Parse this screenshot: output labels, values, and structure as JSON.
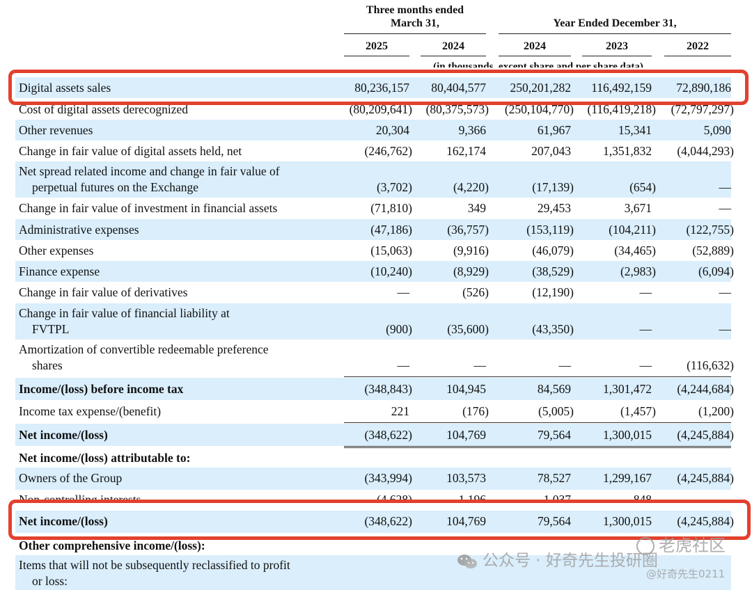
{
  "header": {
    "group1": "Three months ended\nMarch 31,",
    "group2": "Year Ended December 31,",
    "years": [
      "2025",
      "2024",
      "2024",
      "2023",
      "2022"
    ],
    "units_note": "(in thousands, except share and per share data)"
  },
  "rows": [
    {
      "label": "Digital assets sales",
      "values": [
        "80,236,157",
        "80,404,577",
        "250,201,282",
        "116,492,159",
        "72,890,186"
      ]
    },
    {
      "label": "Cost of digital assets derecognized",
      "values": [
        "(80,209,641)",
        "(80,375,573)",
        "(250,104,770)",
        "(116,419,218)",
        "(72,797,297)"
      ]
    },
    {
      "label": "Other revenues",
      "values": [
        "20,304",
        "9,366",
        "61,967",
        "15,341",
        "5,090"
      ]
    },
    {
      "label": "Change in fair value of digital assets held, net",
      "values": [
        "(246,762)",
        "162,174",
        "207,043",
        "1,351,832",
        "(4,044,293)"
      ]
    },
    {
      "label": "Net spread related income and change in fair value of\nperpetual futures on the Exchange",
      "values": [
        "(3,702)",
        "(4,220)",
        "(17,139)",
        "(654)",
        "—"
      ]
    },
    {
      "label": "Change in fair value of investment in financial assets",
      "values": [
        "(71,810)",
        "349",
        "29,453",
        "3,671",
        "—"
      ]
    },
    {
      "label": "Administrative expenses",
      "values": [
        "(47,186)",
        "(36,757)",
        "(153,119)",
        "(104,211)",
        "(122,755)"
      ]
    },
    {
      "label": "Other expenses",
      "values": [
        "(15,063)",
        "(9,916)",
        "(46,079)",
        "(34,465)",
        "(52,889)"
      ]
    },
    {
      "label": "Finance expense",
      "values": [
        "(10,240)",
        "(8,929)",
        "(38,529)",
        "(2,983)",
        "(6,094)"
      ]
    },
    {
      "label": "Change in fair value of derivatives",
      "values": [
        "—",
        "(526)",
        "(12,190)",
        "—",
        "—"
      ]
    },
    {
      "label": "Change in fair value of financial liability at\nFVTPL",
      "values": [
        "(900)",
        "(35,600)",
        "(43,350)",
        "—",
        "—"
      ]
    },
    {
      "label": "Amortization of convertible redeemable preference\nshares",
      "values": [
        "—",
        "—",
        "—",
        "—",
        "(116,632)"
      ]
    },
    {
      "label": "Income/(loss) before income tax",
      "values": [
        "(348,843)",
        "104,945",
        "84,569",
        "1,301,472",
        "(4,244,684)"
      ]
    },
    {
      "label": "Income tax expense/(benefit)",
      "values": [
        "221",
        "(176)",
        "(5,005)",
        "(1,457)",
        "(1,200)"
      ]
    },
    {
      "label": "Net income/(loss)",
      "values": [
        "(348,622)",
        "104,769",
        "79,564",
        "1,300,015",
        "(4,245,884)"
      ]
    },
    {
      "label": "Net income/(loss) attributable to:",
      "values": []
    },
    {
      "label": "Owners of the Group",
      "values": [
        "(343,994)",
        "103,573",
        "78,527",
        "1,299,167",
        "(4,245,884)"
      ]
    },
    {
      "label": "Non-controlling interests",
      "values": [
        "(4,628)",
        "1,196",
        "1,037",
        "848",
        ""
      ]
    },
    {
      "label": "Net income/(loss)",
      "values": [
        "(348,622)",
        "104,769",
        "79,564",
        "1,300,015",
        "(4,245,884)"
      ]
    },
    {
      "label": "Other comprehensive income/(loss):",
      "values": []
    },
    {
      "label": "Items that will not be subsequently reclassified to profit\nor loss:",
      "values": []
    }
  ],
  "watermark": {
    "left_text": "公众号 · 好奇先生投研圈",
    "right_text": "老虎社区",
    "handle": "@好奇先生0211"
  }
}
